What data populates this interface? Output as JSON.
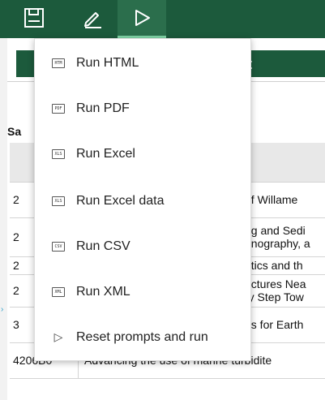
{
  "toolbar": {
    "buttons": [
      {
        "icon": "save-icon"
      },
      {
        "icon": "pencil-icon"
      },
      {
        "icon": "play-icon",
        "active": true
      }
    ]
  },
  "background": {
    "header_text": "t",
    "section_label": "Sa",
    "table_rows": [
      {
        "id": "2",
        "title": "of Willame"
      },
      {
        "id": "2",
        "title_lines": [
          "ng and Sedi",
          "anography, a"
        ]
      },
      {
        "id": "2",
        "title": "atics and th"
      },
      {
        "id": "2",
        "title_lines": [
          "uctures Nea",
          "ry Step Tow"
        ]
      },
      {
        "id": "3",
        "title": "es for Earth"
      },
      {
        "id": "4206B0",
        "title": "Advancing the use of marine turbidite"
      }
    ]
  },
  "menu": {
    "items": [
      {
        "icon_text": "HTM",
        "label": "Run HTML"
      },
      {
        "icon_text": "PDF",
        "label": "Run PDF"
      },
      {
        "icon_text": "XLS",
        "label": "Run Excel"
      },
      {
        "icon_text": "XLS",
        "label": "Run Excel data"
      },
      {
        "icon_text": "CSV",
        "label": "Run CSV"
      },
      {
        "icon_text": "XML",
        "label": "Run XML"
      },
      {
        "icon_text": "▷",
        "label": "Reset prompts and run"
      }
    ]
  },
  "colors": {
    "toolbar_bg": "#1c5a3c",
    "active_underline": "#7fd3a5"
  }
}
